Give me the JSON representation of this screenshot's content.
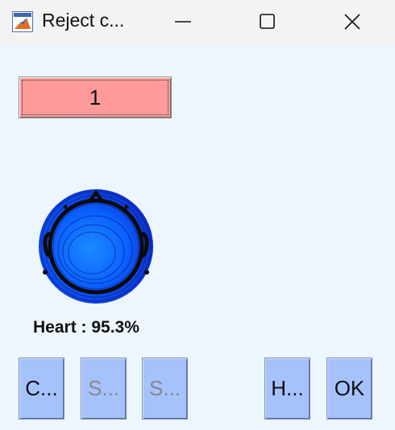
{
  "window": {
    "title": "Reject c...",
    "icon": "matlab-icon",
    "controls": [
      "minimize-icon",
      "maximize-icon",
      "close-icon"
    ]
  },
  "component": {
    "number": "1",
    "color": "#ff9a9a"
  },
  "topoplot": {
    "label": "Heart : 95.3%"
  },
  "buttons": {
    "c_label": "C...",
    "s1_label": "S...",
    "s2_label": "S...",
    "h_label": "H...",
    "ok_label": "OK",
    "color": "#a6c2fd"
  }
}
